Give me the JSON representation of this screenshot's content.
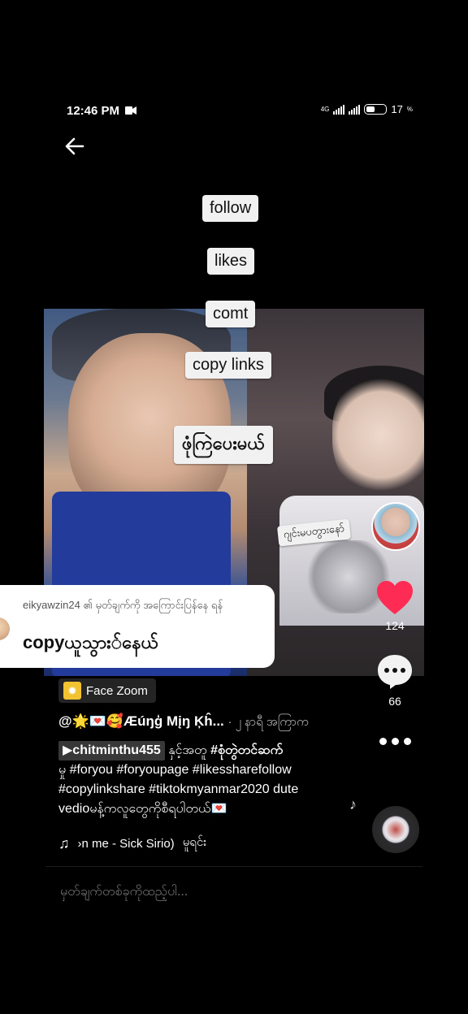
{
  "status_bar": {
    "time": "12:46 PM",
    "network": "4G",
    "battery": "17"
  },
  "nav": {
    "back_icon": "arrow-left-icon"
  },
  "video": {
    "stickers": {
      "follow": "follow",
      "likes": "likes",
      "comt": "comt",
      "copy_links": "copy links",
      "burmese": "ဖုံကြဲပေးမယ်",
      "small": "ဂျင်းမပတွားနော်"
    }
  },
  "actions": {
    "like_count": "124",
    "comment_count": "66"
  },
  "comment_popup": {
    "header": "eikyawzin24 ၏ မှတ်ချက်ကို အကြောင်းပြန်နေ ရန်",
    "text": "copyယူသွား်နေယ်"
  },
  "effect": {
    "label": "Face Zoom"
  },
  "caption": {
    "author": "@🌟💌🥰Æúŋģ Mįŋ Ķĥ...",
    "time_ago": "· ၂ နာရီ အကြာက",
    "mention": "▶chitminthu455",
    "text_after_mention": "နှင့်အတူ",
    "hashtag_1": "#စုံတွဲတင်ဆက်",
    "line2": "မှု #foryou #foryoupage #likessharefollow",
    "line3": "#copylinkshare #tiktokmyanmar2020 dute",
    "line4": "vedioမန့်ကလူတွေကိုစီရပါတယ်💌"
  },
  "music": {
    "text": "›n me - Sick Sirio)",
    "text2": "မူရင်း"
  },
  "comment_input": {
    "placeholder": "မှတ်ချက်တစ်ခုကိုထည့်ပါ..."
  },
  "colors": {
    "like": "#fe2c55",
    "background": "#000000"
  }
}
